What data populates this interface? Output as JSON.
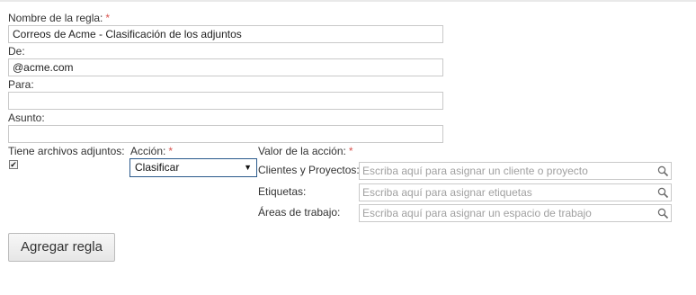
{
  "form": {
    "rule_name_label": "Nombre de la regla:",
    "rule_name_value": "Correos de Acme - Clasificación de los adjuntos",
    "from_label": "De:",
    "from_value": "@acme.com",
    "to_label": "Para:",
    "to_value": "",
    "subject_label": "Asunto:",
    "subject_value": "",
    "has_attachments_label": "Tiene archivos adjuntos:",
    "has_attachments_checked": true,
    "action_label": "Acción:",
    "action_selected": "Clasificar",
    "action_value_label": "Valor de la acción:",
    "required_marker": "*"
  },
  "action_values": [
    {
      "label": "Clientes y Proyectos:",
      "placeholder": "Escriba aquí para asignar un cliente o proyecto"
    },
    {
      "label": "Etiquetas:",
      "placeholder": "Escriba aquí para asignar etiquetas"
    },
    {
      "label": "Áreas de trabajo:",
      "placeholder": "Escriba aquí para asignar un espacio de trabajo"
    }
  ],
  "buttons": {
    "add_rule": "Agregar regla"
  },
  "icons": {
    "search": "magnifier-icon",
    "check": "check-icon",
    "dropdown": "triangle-down-icon"
  },
  "colors": {
    "required": "#d9534f",
    "select_border": "#2a5a8c",
    "placeholder": "#a0a0a0"
  }
}
